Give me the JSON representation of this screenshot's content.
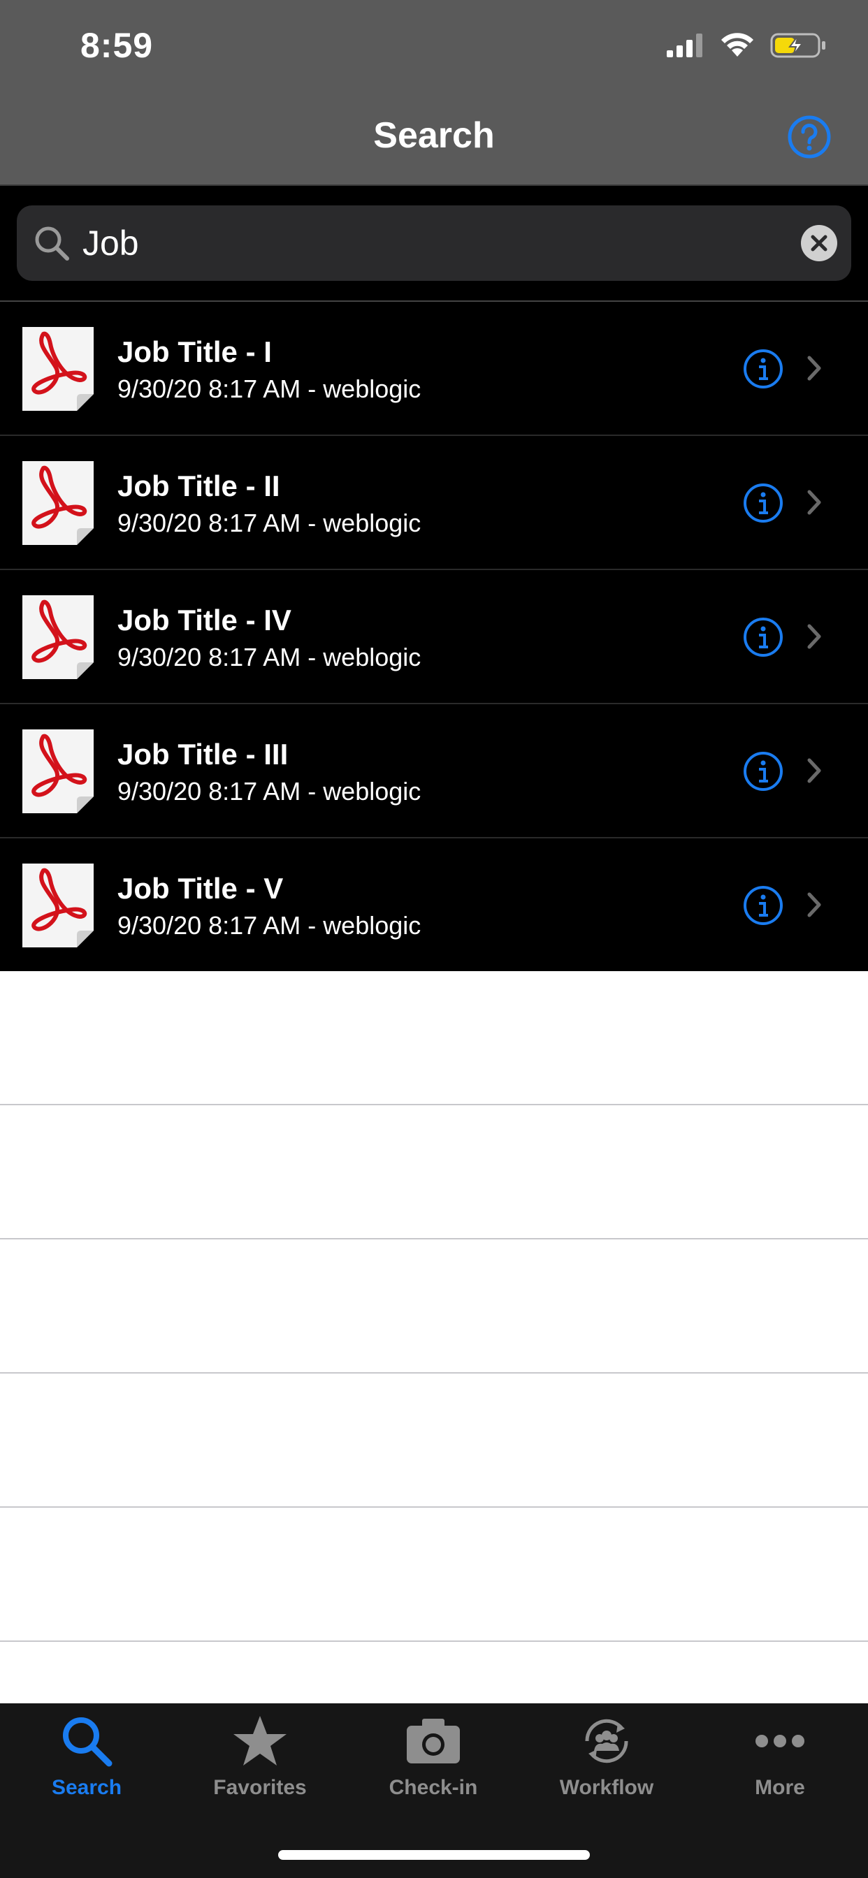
{
  "status_bar": {
    "time": "8:59"
  },
  "nav": {
    "title": "Search",
    "help_icon": "question-circle-icon"
  },
  "search": {
    "value": "Job",
    "clear_icon": "clear-x-icon"
  },
  "results": [
    {
      "title": "Job Title - I",
      "subtitle": "9/30/20 8:17 AM - weblogic"
    },
    {
      "title": "Job Title - II",
      "subtitle": "9/30/20 8:17 AM - weblogic"
    },
    {
      "title": "Job Title - IV",
      "subtitle": "9/30/20 8:17 AM - weblogic"
    },
    {
      "title": "Job Title - III",
      "subtitle": "9/30/20 8:17 AM - weblogic"
    },
    {
      "title": "Job Title - V",
      "subtitle": "9/30/20 8:17 AM - weblogic"
    }
  ],
  "tabs": [
    {
      "label": "Search",
      "icon": "search-icon",
      "active": true
    },
    {
      "label": "Favorites",
      "icon": "star-icon",
      "active": false
    },
    {
      "label": "Check-in",
      "icon": "camera-icon",
      "active": false
    },
    {
      "label": "Workflow",
      "icon": "workflow-icon",
      "active": false
    },
    {
      "label": "More",
      "icon": "more-dots-icon",
      "active": false
    }
  ],
  "colors": {
    "accent": "#1a7cf0",
    "bar": "#5a5a5a",
    "pdf_red": "#d3121b"
  }
}
